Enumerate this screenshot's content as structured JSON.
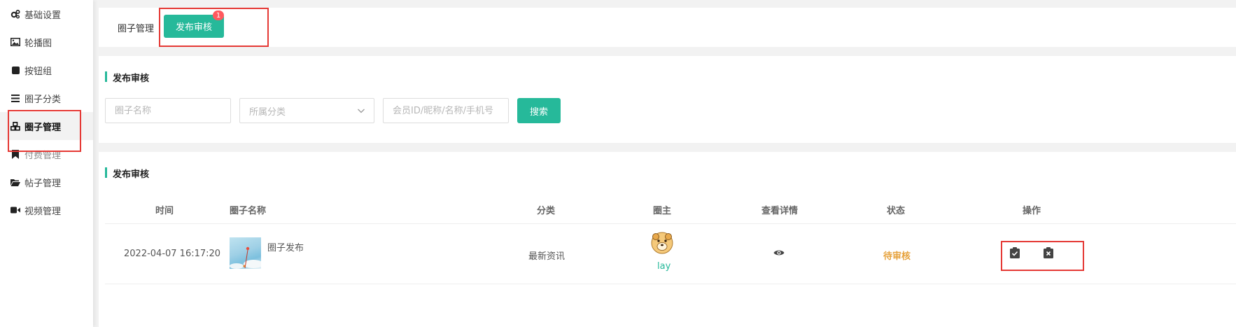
{
  "sidebar": {
    "items": [
      {
        "label": "基础设置",
        "icon": "gears-icon"
      },
      {
        "label": "轮播图",
        "icon": "image-icon"
      },
      {
        "label": "按钮组",
        "icon": "square-icon"
      },
      {
        "label": "圈子分类",
        "icon": "list-icon"
      },
      {
        "label": "圈子管理",
        "icon": "cubes-icon"
      },
      {
        "label": "付费管理",
        "icon": "bookmark-icon"
      },
      {
        "label": "帖子管理",
        "icon": "folder-open-icon"
      },
      {
        "label": "视频管理",
        "icon": "video-camera-icon"
      }
    ]
  },
  "tabs": {
    "items": [
      {
        "label": "圈子管理"
      },
      {
        "label": "发布审核",
        "badge": "1"
      }
    ]
  },
  "search": {
    "title": "发布审核",
    "name_placeholder": "圈子名称",
    "category_placeholder": "所属分类",
    "member_placeholder": "会员ID/昵称/名称/手机号",
    "button_label": "搜索"
  },
  "table": {
    "title": "发布审核",
    "headers": [
      "时间",
      "圈子名称",
      "分类",
      "圈主",
      "查看详情",
      "状态",
      "操作"
    ],
    "rows": [
      {
        "time": "2022-04-07 16:17:20",
        "name": "圈子发布",
        "category": "最新资讯",
        "owner": "lay",
        "status": "待审核"
      }
    ]
  },
  "colors": {
    "accent": "#26b99a",
    "badge": "#ff5a5f",
    "status_pending": "#e6a23c",
    "annotation": "#e53935"
  }
}
